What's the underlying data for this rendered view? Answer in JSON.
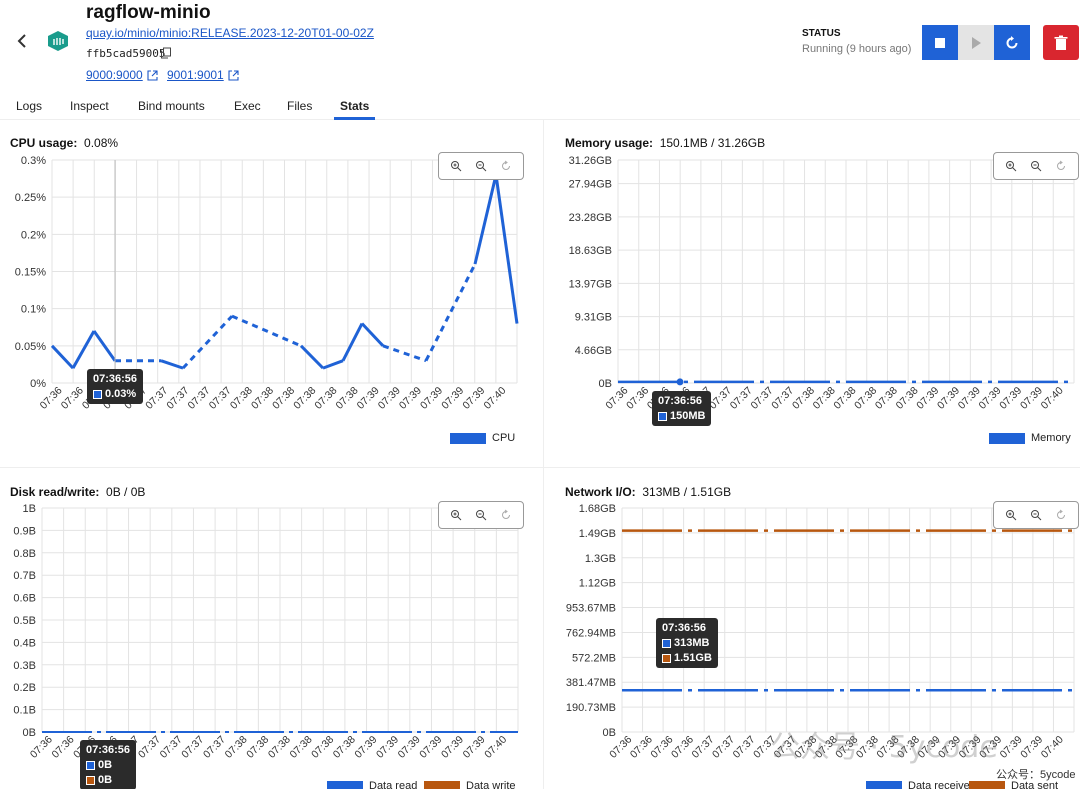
{
  "header": {
    "title": "ragflow-minio",
    "image": "quay.io/minio/minio:RELEASE.2023-12-20T01-00-02Z",
    "container_id": "ffb5cad59005",
    "ports": [
      "9000:9000",
      "9001:9001"
    ],
    "status_label": "STATUS",
    "status_value": "Running (9 hours ago)"
  },
  "tabs": [
    {
      "label": "Logs"
    },
    {
      "label": "Inspect"
    },
    {
      "label": "Bind mounts"
    },
    {
      "label": "Exec"
    },
    {
      "label": "Files"
    },
    {
      "label": "Stats",
      "active": true
    }
  ],
  "colors": {
    "accent": "#1f62d6",
    "danger": "#d9262f",
    "series_blue": "#1f62d6",
    "series_orange": "#b8570f"
  },
  "panels": {
    "cpu": {
      "label": "CPU usage:",
      "value": "0.08%"
    },
    "memory": {
      "label": "Memory usage:",
      "value": "150.1MB / 31.26GB"
    },
    "disk": {
      "label": "Disk read/write:",
      "value": "0B / 0B"
    },
    "network": {
      "label": "Network I/O:",
      "value": "313MB / 1.51GB"
    }
  },
  "tooltips": {
    "cpu": {
      "time": "07:36:56",
      "rows": [
        "0.03%"
      ]
    },
    "memory": {
      "time": "07:36:56",
      "rows": [
        "150MB"
      ]
    },
    "disk": {
      "time": "07:36:56",
      "rows": [
        "0B",
        "0B"
      ]
    },
    "network": {
      "time": "07:36:56",
      "rows": [
        "313MB",
        "1.51GB"
      ]
    }
  },
  "watermark": {
    "text": "公众号 · 5ycode",
    "small": "公众号：5ycode"
  },
  "chart_data": [
    {
      "id": "cpu",
      "type": "line",
      "ylabel": "",
      "ticks": [
        "0%",
        "0.05%",
        "0.1%",
        "0.15%",
        "0.2%",
        "0.25%",
        "0.3%"
      ],
      "ylim": [
        0,
        0.3
      ],
      "x_labels": [
        "07:36",
        "07:36",
        "07:36",
        "07:36",
        "07:37",
        "07:37",
        "07:37",
        "07:37",
        "07:37",
        "07:38",
        "07:38",
        "07:38",
        "07:38",
        "07:38",
        "07:38",
        "07:39",
        "07:39",
        "07:39",
        "07:39",
        "07:39",
        "07:39",
        "07:40"
      ],
      "series": [
        {
          "name": "CPU",
          "color": "#1f62d6",
          "values": [
            0.05,
            0.02,
            0.07,
            0.03,
            0.03,
            0.03,
            0.03,
            0.02,
            0.05,
            0.09,
            0.08,
            0.07,
            0.06,
            0.05,
            0.02,
            0.03,
            0.08,
            0.05,
            0.04,
            0.03,
            0.09,
            0.16,
            0.28,
            0.08
          ],
          "dashed_segments": [
            3,
            4,
            7,
            8,
            9,
            11,
            12,
            19,
            20
          ]
        }
      ],
      "grid": true,
      "legend": "bottom-right"
    },
    {
      "id": "memory",
      "type": "line",
      "ticks": [
        "0B",
        "4.66GB",
        "9.31GB",
        "13.97GB",
        "18.63GB",
        "23.28GB",
        "27.94GB",
        "31.26GB"
      ],
      "ylim": [
        0,
        31.26
      ],
      "x_labels": [
        "07:36",
        "07:36",
        "07:36",
        "07:36",
        "07:37",
        "07:37",
        "07:37",
        "07:37",
        "07:37",
        "07:38",
        "07:38",
        "07:38",
        "07:38",
        "07:38",
        "07:38",
        "07:39",
        "07:39",
        "07:39",
        "07:39",
        "07:39",
        "07:39",
        "07:40"
      ],
      "series": [
        {
          "name": "Memory",
          "color": "#1f62d6",
          "values_gb": 0.15
        }
      ],
      "grid": true,
      "legend": "bottom-right"
    },
    {
      "id": "disk",
      "type": "line",
      "ticks": [
        "0B",
        "0.1B",
        "0.2B",
        "0.3B",
        "0.4B",
        "0.5B",
        "0.6B",
        "0.7B",
        "0.8B",
        "0.9B",
        "1B"
      ],
      "ylim": [
        0,
        1
      ],
      "x_labels": [
        "07:36",
        "07:36",
        "07:36",
        "07:36",
        "07:37",
        "07:37",
        "07:37",
        "07:37",
        "07:37",
        "07:38",
        "07:38",
        "07:38",
        "07:38",
        "07:38",
        "07:38",
        "07:39",
        "07:39",
        "07:39",
        "07:39",
        "07:39",
        "07:39",
        "07:40"
      ],
      "series": [
        {
          "name": "Data read",
          "color": "#1f62d6",
          "values": 0
        },
        {
          "name": "Data write",
          "color": "#b8570f",
          "values": 0
        }
      ],
      "grid": true,
      "legend": "bottom-right"
    },
    {
      "id": "network",
      "type": "line",
      "ticks": [
        "0B",
        "190.73MB",
        "381.47MB",
        "572.2MB",
        "762.94MB",
        "953.67MB",
        "1.12GB",
        "1.3GB",
        "1.49GB",
        "1.68GB"
      ],
      "ylim": [
        0,
        1.68
      ],
      "x_labels": [
        "07:36",
        "07:36",
        "07:36",
        "07:36",
        "07:37",
        "07:37",
        "07:37",
        "07:37",
        "07:37",
        "07:38",
        "07:38",
        "07:38",
        "07:38",
        "07:38",
        "07:38",
        "07:39",
        "07:39",
        "07:39",
        "07:39",
        "07:39",
        "07:39",
        "07:40"
      ],
      "series": [
        {
          "name": "Data received",
          "color": "#1f62d6",
          "value_gb": 0.313
        },
        {
          "name": "Data sent",
          "color": "#b8570f",
          "value_gb": 1.51
        }
      ],
      "grid": true,
      "legend": "bottom-right"
    }
  ]
}
